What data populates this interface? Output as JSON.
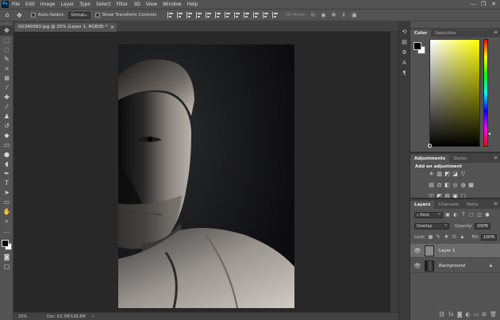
{
  "app": {
    "logo": "Ps"
  },
  "menubar": {
    "items": [
      "File",
      "Edit",
      "Image",
      "Layer",
      "Type",
      "Select",
      "Filter",
      "3D",
      "View",
      "Window",
      "Help"
    ],
    "window_controls": [
      "—",
      "❐",
      "✕"
    ]
  },
  "options": {
    "auto_select_label": "Auto-Select:",
    "auto_select_target": "Group",
    "show_transform_label": "Show Transform Controls",
    "mode_3d_label": "3D Mode:"
  },
  "document": {
    "tab_title": "0G3A0083.jpg @ 25% (Layer 1, RGB/8) *",
    "tab_close": "×"
  },
  "statusbar": {
    "zoom": "25%",
    "doc_info": "Doc: 63.3M/126.6M",
    "arrow": "›"
  },
  "color_panel": {
    "tabs": [
      "Color",
      "Swatches"
    ],
    "foreground": "#000000",
    "background": "#ffffff",
    "hue": "#ffff00"
  },
  "adjustments_panel": {
    "tabs": [
      "Adjustments",
      "Styles"
    ],
    "title": "Add an adjustment",
    "row1": [
      "☀",
      "▥",
      "◩",
      "◪",
      "▽"
    ],
    "row2": [
      "▤",
      "⚖",
      "◧",
      "◎",
      "◍",
      "▦"
    ],
    "row3": [
      "◫",
      "◩",
      "▨",
      "▣",
      "▢"
    ]
  },
  "layers_panel": {
    "tabs": [
      "Layers",
      "Channels",
      "Paths"
    ],
    "filter_kind": "Kind",
    "blend_mode": "Overlay",
    "opacity_label": "Opacity:",
    "opacity_value": "100%",
    "lock_label": "Lock:",
    "fill_label": "Fill:",
    "fill_value": "100%",
    "layers": [
      {
        "name": "Layer 1",
        "selected": true,
        "italic": false
      },
      {
        "name": "Background",
        "selected": false,
        "italic": true
      }
    ]
  }
}
